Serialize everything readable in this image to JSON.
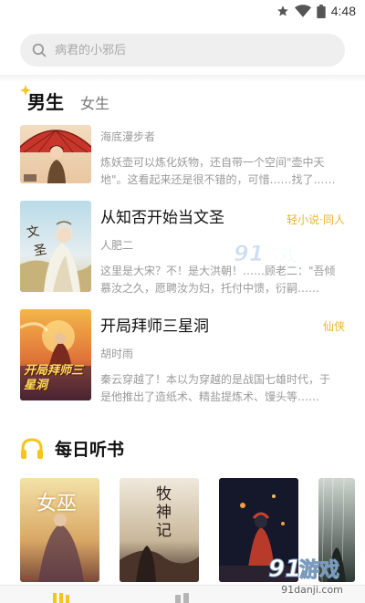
{
  "status_bar": {
    "time": "4:48",
    "icons": [
      "star-icon",
      "wifi-icon",
      "battery-icon"
    ]
  },
  "search": {
    "placeholder": "病君的小邪后"
  },
  "tabs": [
    {
      "label": "男生",
      "active": true
    },
    {
      "label": "女生",
      "active": false
    }
  ],
  "books": [
    {
      "title": "",
      "genre": "",
      "author": "海底漫步者",
      "description": "炼妖壶可以炼化妖物，还自带一个空间\"壶中天地\"。这看起来还是很不错的，可惜……找了……"
    },
    {
      "title": "从知否开始当文圣",
      "genre": "轻小说·同人",
      "author": "人肥二",
      "description": "这里是大宋？不！是大洪朝！……顾老二：\"吾倾慕汝之久，愿聘汝为妇，托付中馈，衍嗣……"
    },
    {
      "title": "开局拜师三星洞",
      "genre": "仙侠",
      "author": "胡时雨",
      "description": "秦云穿越了！本以为穿越的是战国七雄时代，于是他推出了造纸术、精盐提炼术、馒头等……",
      "cover_text": "开局拜师三星洞"
    }
  ],
  "daily_audio": {
    "title": "每日听书",
    "covers": [
      {
        "cover_text": "女巫"
      },
      {
        "cover_text": "牧神记"
      },
      {
        "cover_text": ""
      },
      {
        "cover_text": ""
      }
    ]
  },
  "watermark": {
    "brand": "91游戏",
    "url": "91danji.com"
  },
  "colors": {
    "accent": "#f5c518",
    "genre": "#e8b62c",
    "muted": "#9a9a9a"
  }
}
